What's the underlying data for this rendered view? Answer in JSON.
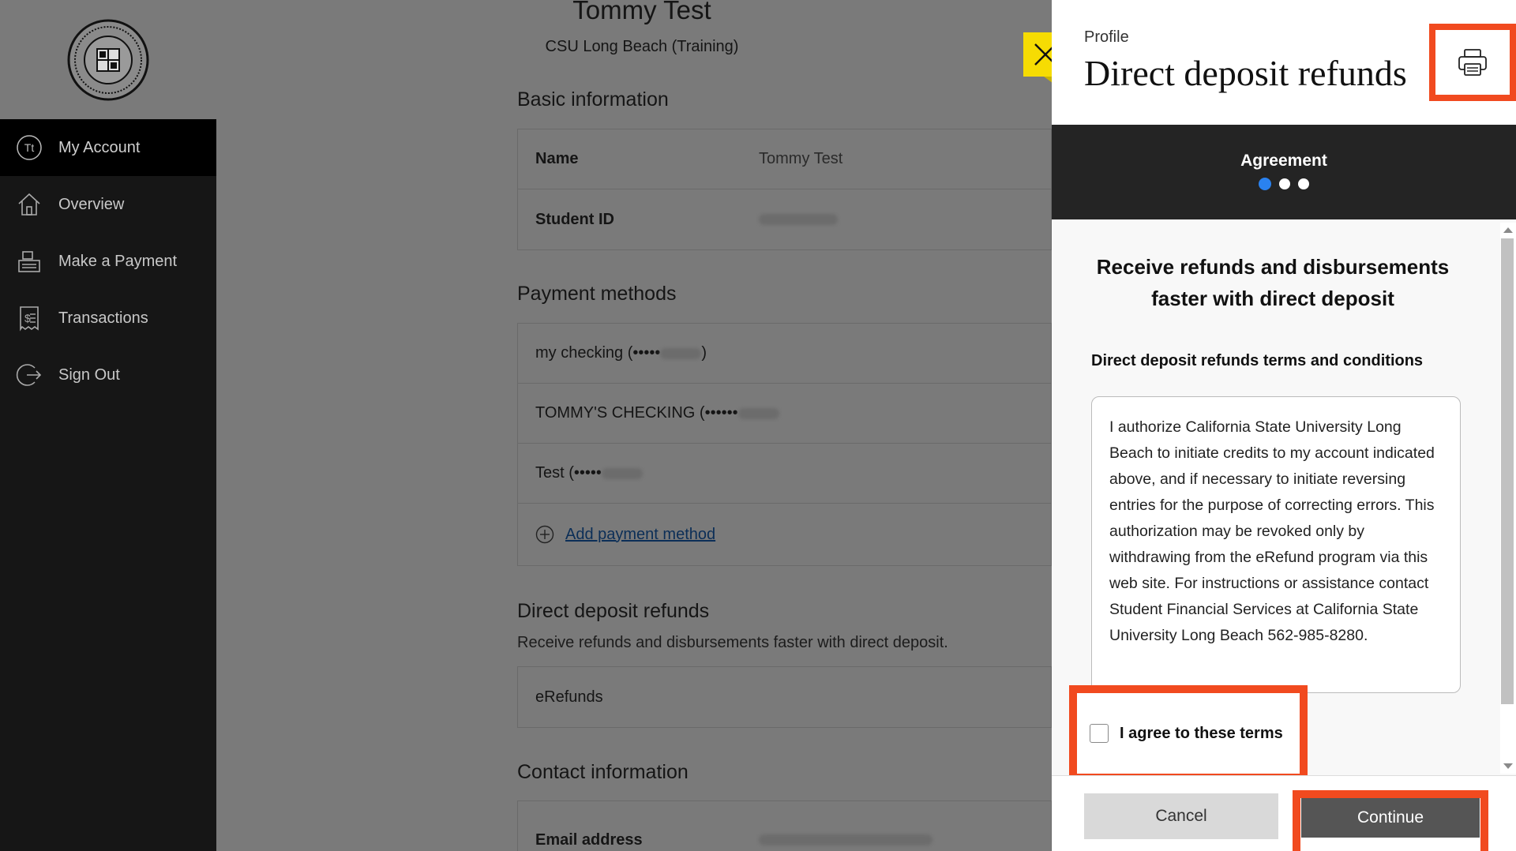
{
  "sidebar": {
    "items": [
      {
        "label": "My Account",
        "icon": "user-initials-icon",
        "initials": "Tt",
        "active": true
      },
      {
        "label": "Overview",
        "icon": "home-icon"
      },
      {
        "label": "Make a Payment",
        "icon": "cash-register-icon"
      },
      {
        "label": "Transactions",
        "icon": "receipt-icon"
      },
      {
        "label": "Sign Out",
        "icon": "sign-out-icon"
      }
    ]
  },
  "header": {
    "name": "Tommy Test",
    "school": "CSU Long Beach (Training)"
  },
  "basic_info": {
    "title": "Basic information",
    "name_label": "Name",
    "name_value": "Tommy Test",
    "student_id_label": "Student ID"
  },
  "payment_methods": {
    "title": "Payment methods",
    "items": [
      {
        "prefix": "my checking (•••••",
        "suffix": ")"
      },
      {
        "prefix": "TOMMY'S CHECKING (••••••",
        "suffix": ""
      },
      {
        "prefix": "Test (•••••",
        "suffix": ""
      }
    ],
    "add_label": "Add payment method"
  },
  "direct_deposit": {
    "title": "Direct deposit refunds",
    "description": "Receive refunds and disbursements faster with direct deposit.",
    "row_label": "eRefunds"
  },
  "contact": {
    "title": "Contact information",
    "email_label": "Email address"
  },
  "drawer": {
    "crumb": "Profile",
    "title": "Direct deposit refunds",
    "step_label": "Agreement",
    "step_total": 3,
    "step_current": 1,
    "promo": "Receive refunds and disbursements faster with direct deposit",
    "terms_title": "Direct deposit refunds terms and conditions",
    "terms_text": "I authorize California State University Long Beach to initiate credits to my account indicated above, and if necessary to initiate reversing entries for the purpose of correcting errors. This authorization may be revoked only by withdrawing from the eRefund program via this web site. For instructions or assistance contact Student Financial Services at California State University Long Beach 562-985-8280.",
    "agree_label": "I agree to these terms",
    "agree_checked": false,
    "cancel_label": "Cancel",
    "continue_label": "Continue"
  },
  "colors": {
    "highlight": "#f14a1f",
    "close_button": "#f6dc03",
    "step_active": "#2a82f0"
  }
}
